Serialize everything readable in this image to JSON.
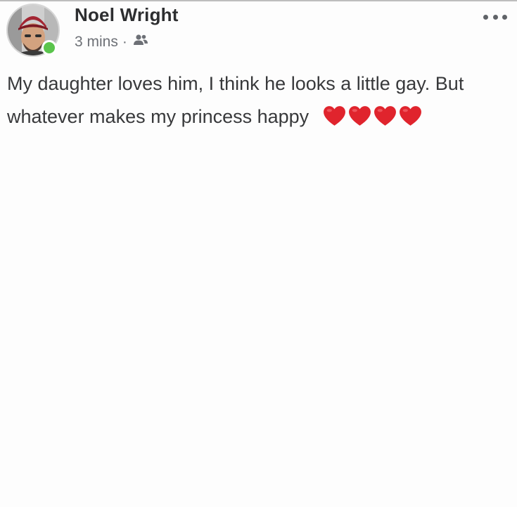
{
  "post": {
    "author": "Noel Wright",
    "timestamp": "3 mins",
    "separator": "·",
    "audience_icon": "friends-icon",
    "text_line1": "My daughter loves him, I think he looks a little gay. But",
    "text_line2": "whatever makes my princess happy",
    "emoji": "red-heart-icon",
    "emoji_count": 4,
    "more_icon": "more-options-icon"
  },
  "colors": {
    "online_status": "#5ac44c",
    "heart": "#e0242d",
    "meta_text": "#6d7076"
  }
}
